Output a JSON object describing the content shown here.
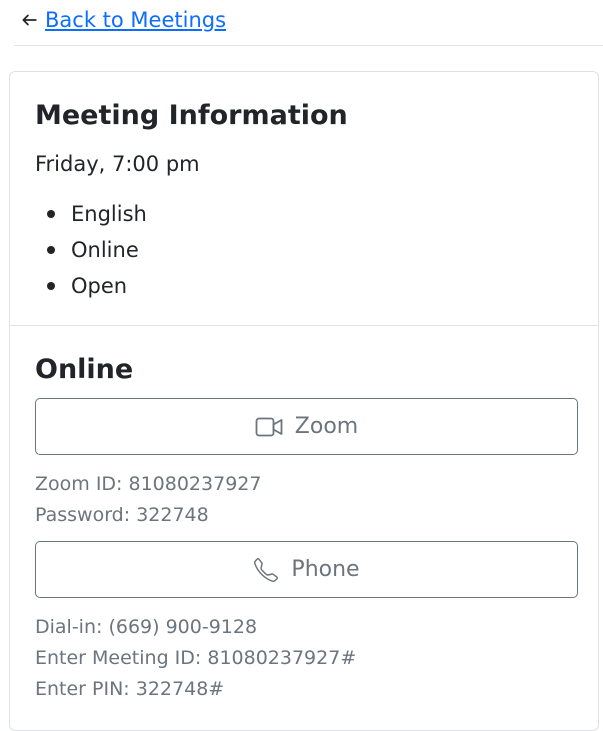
{
  "nav": {
    "back_label": "Back to Meetings",
    "back_icon": "arrow-left-icon"
  },
  "meeting": {
    "title": "Meeting Information",
    "when": "Friday, 7:00 pm",
    "types": [
      "English",
      "Online",
      "Open"
    ]
  },
  "online": {
    "title": "Online",
    "zoom_button": {
      "label": "Zoom",
      "icon": "video-camera-icon"
    },
    "zoom_id": "Zoom ID: 81080237927",
    "zoom_password": "Password: 322748",
    "phone_button": {
      "label": "Phone",
      "icon": "phone-icon"
    },
    "dial_in": "Dial-in: (669) 900-9128",
    "meeting_id": "Enter Meeting ID: 81080237927#",
    "pin": "Enter PIN: 322748#"
  },
  "colors": {
    "link": "#0d6efd",
    "muted": "#6c757d",
    "text": "#212529",
    "border": "#dee2e6"
  }
}
